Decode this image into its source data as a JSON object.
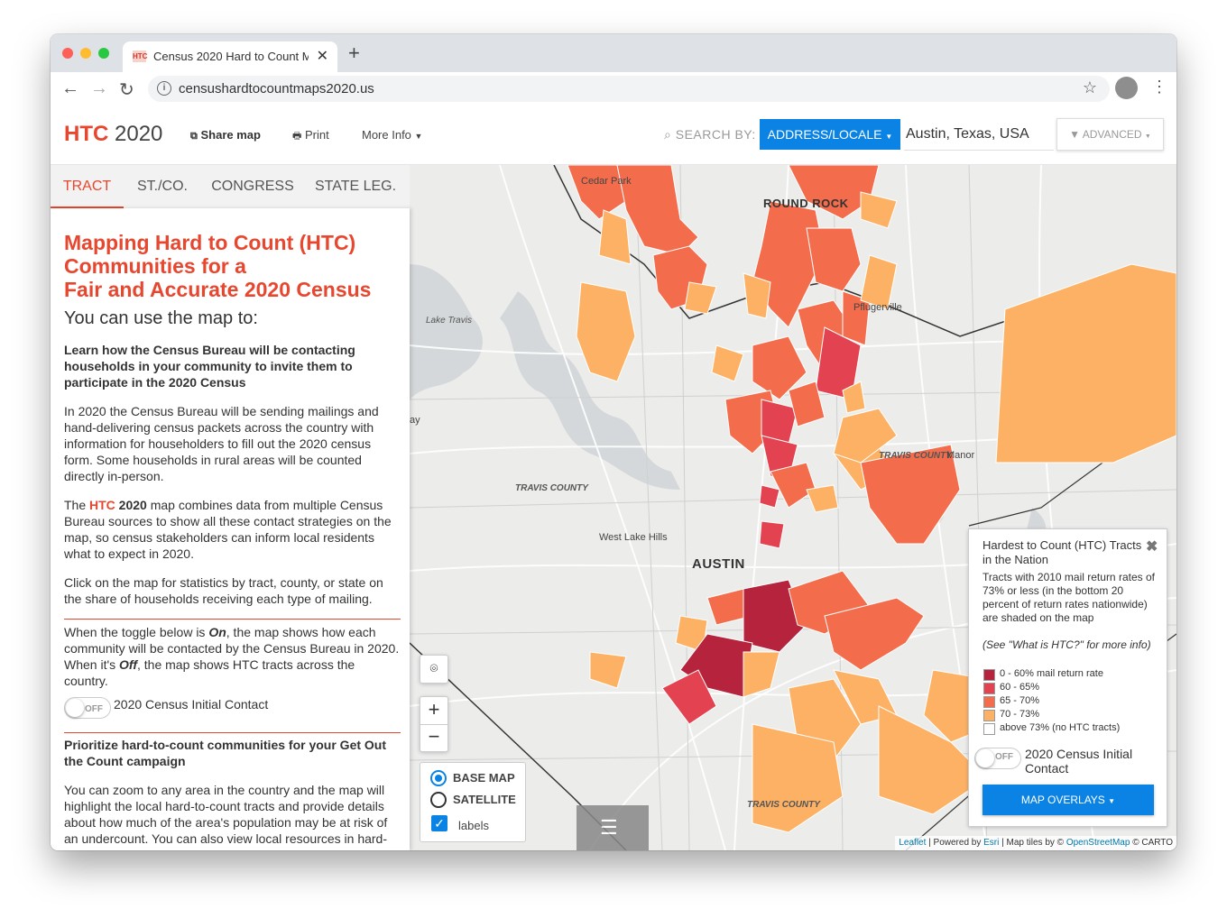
{
  "browser": {
    "tab_title": "Census 2020 Hard to Count M",
    "tab_favicon": "HTC",
    "url": "censushardtocountmaps2020.us"
  },
  "header": {
    "logo_strong": "HTC",
    "logo_rest": " 2020",
    "share_label": "Share map",
    "print_label": "Print",
    "more_info_label": "More Info",
    "search_by_label": "SEARCH BY:",
    "address_button_label": "ADDRESS/LOCALE",
    "search_value": "Austin, Texas, USA",
    "advanced_label": "ADVANCED",
    "accent_color": "#e8472f",
    "button_color": "#0a83e5"
  },
  "tabs": [
    {
      "label": "TRACT",
      "active": true
    },
    {
      "label": "ST./CO.",
      "active": false
    },
    {
      "label": "CONGRESS",
      "active": false
    },
    {
      "label": "STATE LEG.",
      "active": false
    }
  ],
  "sidebar": {
    "title_line1": "Mapping Hard to Count (HTC)",
    "title_line2": "Communities for a",
    "title_line3": "Fair and Accurate 2020 Census",
    "subtitle": "You can use the map to:",
    "heading1": "Learn how the Census Bureau will be contacting households in your community to invite them to participate in the 2020 Census",
    "para1": "In 2020 the Census Bureau will be sending mailings and hand-delivering census packets across the country with information for householders to fill out the 2020 census form. Some households in rural areas will be counted directly in-person.",
    "para2_pre": "The ",
    "para2_htc": "HTC",
    "para2_year": " 2020",
    "para2_post": " map combines data from multiple Census Bureau sources to show all these contact strategies on the map, so census stakeholders can inform local residents what to expect in 2020.",
    "para3": "Click on the map for statistics by tract, county, or state on the share of households receiving each type of mailing.",
    "para4_a": "When the toggle below is ",
    "para4_on": "On",
    "para4_b": ", the map shows how each community will be contacted by the Census Bureau in 2020. When it's ",
    "para4_off": "Off",
    "para4_c": ", the map shows HTC tracts across the country.",
    "toggle_state": "OFF",
    "toggle_label": "2020 Census Initial Contact",
    "heading2": "Prioritize hard-to-count communities for your Get Out the Count campaign",
    "para5": "You can zoom to any area in the country and the map will highlight the local hard-to-count tracts and provide details about how much of the area's population may be at risk of an undercount. You can also view local resources in hard-to-count areas, such as public libraries and"
  },
  "map": {
    "labels": [
      {
        "text": "Cedar Park",
        "kind": "place"
      },
      {
        "text": "ROUND ROCK",
        "kind": "city"
      },
      {
        "text": "Pflugerville",
        "kind": "place"
      },
      {
        "text": "Lake Travis",
        "kind": "water"
      },
      {
        "text": "TRAVIS COUNTY",
        "kind": "county"
      },
      {
        "text": "TRAVIS COUNTY",
        "kind": "county"
      },
      {
        "text": "Manor",
        "kind": "place"
      },
      {
        "text": "West Lake Hills",
        "kind": "place"
      },
      {
        "text": "AUSTIN",
        "kind": "city"
      },
      {
        "text": "TRAVIS COUNTY",
        "kind": "county"
      },
      {
        "text": "ay",
        "kind": "place"
      }
    ],
    "base_map_label": "BASE MAP",
    "satellite_label": "SATELLITE",
    "labels_label": "labels",
    "base_map_selected": true,
    "labels_checked": true,
    "zoom_in": "+",
    "zoom_out": "−",
    "attribution": {
      "leaflet": "Leaflet",
      "powered": " | Powered by ",
      "esri": "Esri",
      "tiles": " | Map tiles by © ",
      "osm": "OpenStreetMap",
      "carto": " © CARTO"
    }
  },
  "legend": {
    "title": "Hardest to Count (HTC) Tracts in the Nation",
    "description": "Tracts with 2010 mail return rates of 73% or less (in the bottom 20 percent of return rates nationwide) are shaded on the map",
    "note": "(See \"What is HTC?\" for more info)",
    "items": [
      {
        "label": "0 - 60% mail return rate",
        "color": "#b5233d"
      },
      {
        "label": "60 - 65%",
        "color": "#e34250"
      },
      {
        "label": "65 - 70%",
        "color": "#f36d4c"
      },
      {
        "label": "70 - 73%",
        "color": "#fdb164"
      },
      {
        "label": "above 73% (no HTC tracts)",
        "color": "#ffffff"
      }
    ],
    "toggle_state": "OFF",
    "toggle_label": "2020 Census Initial Contact",
    "overlays_label": "MAP OVERLAYS"
  }
}
